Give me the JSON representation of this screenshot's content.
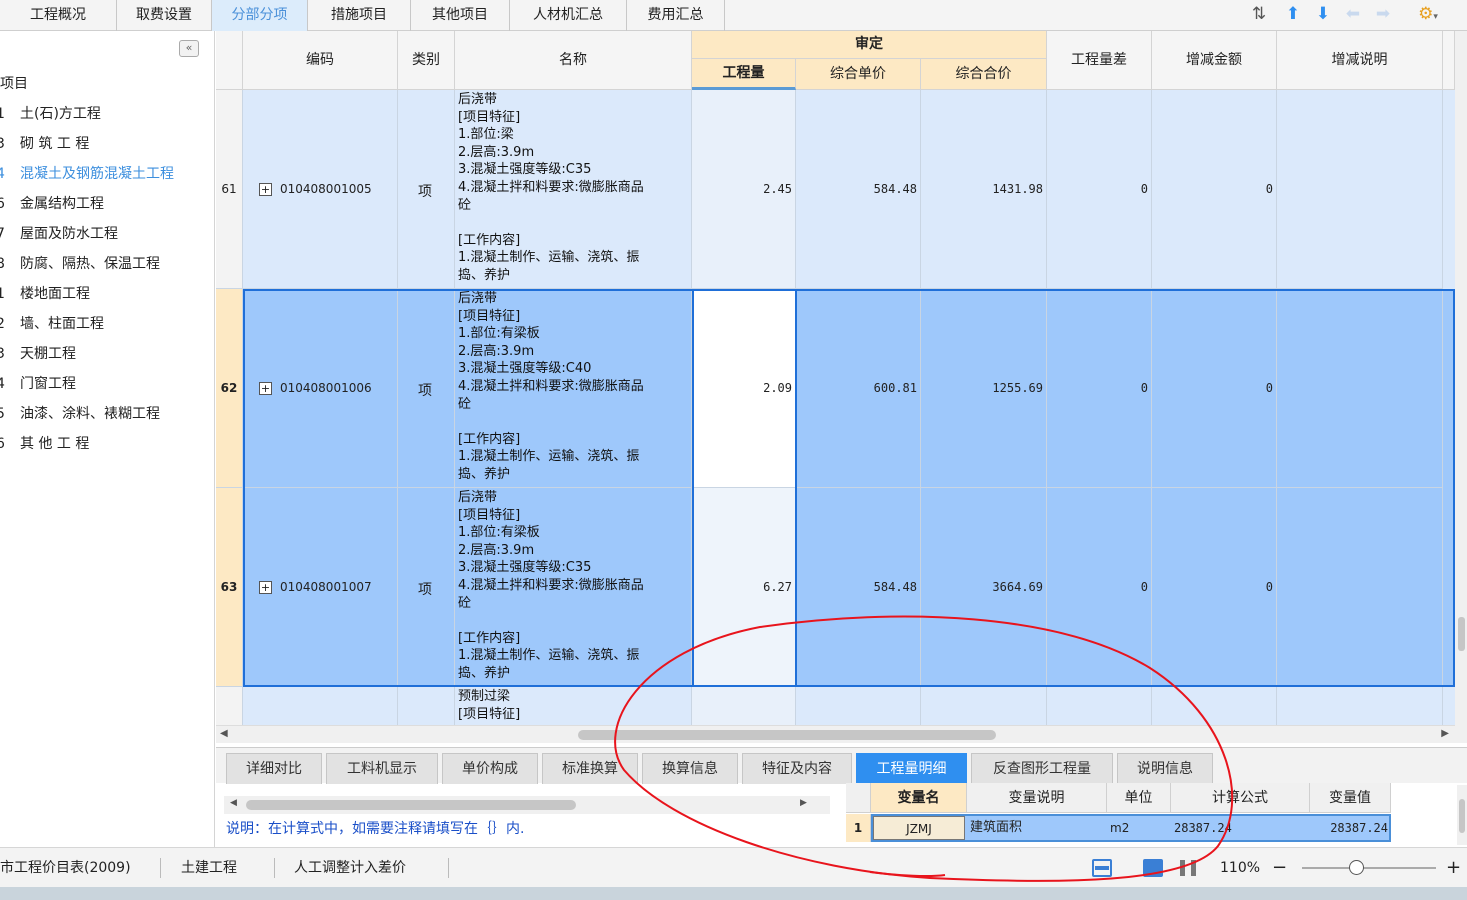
{
  "top_tabs": [
    "工程概况",
    "取费设置",
    "分部分项",
    "措施项目",
    "其他项目",
    "人材机汇总",
    "费用汇总"
  ],
  "active_top_tab": "分部分项",
  "toolbar_icons": [
    "sort-icon",
    "arrow-up-icon",
    "arrow-down-icon",
    "arrow-left-icon",
    "arrow-right-icon",
    "settings-icon"
  ],
  "tree": {
    "root_label": "项目",
    "items": [
      {
        "num": "1",
        "label": "土(石)方工程"
      },
      {
        "num": "3",
        "label": "砌 筑 工 程"
      },
      {
        "num": "4",
        "label": "混凝土及钢筋混凝土工程",
        "active": true
      },
      {
        "num": "6",
        "label": "金属结构工程"
      },
      {
        "num": "7",
        "label": "屋面及防水工程"
      },
      {
        "num": "8",
        "label": "防腐、隔热、保温工程"
      },
      {
        "num": "1",
        "label": "楼地面工程"
      },
      {
        "num": "2",
        "label": "墙、柱面工程"
      },
      {
        "num": "3",
        "label": "天棚工程"
      },
      {
        "num": "4",
        "label": "门窗工程"
      },
      {
        "num": "5",
        "label": "油漆、涂料、裱糊工程"
      },
      {
        "num": "6",
        "label": "其 他 工 程"
      }
    ]
  },
  "grid": {
    "headers": {
      "code": "编码",
      "type": "类别",
      "name": "名称",
      "group": "审定",
      "qty": "工程量",
      "unit_price": "综合单价",
      "total": "综合合价",
      "qty_diff": "工程量差",
      "amount_change": "增减金额",
      "change_note": "增减说明"
    },
    "rows": [
      {
        "row_no": "61",
        "code": "010408001005",
        "type": "项",
        "name": "后浇带\n[项目特征]\n1.部位:梁\n2.层高:3.9m\n3.混凝土强度等级:C35\n4.混凝土拌和料要求:微膨胀商品\n砼\n\n[工作内容]\n1.混凝土制作、运输、浇筑、振\n捣、养护",
        "qty": "2.45",
        "unit_price": "584.48",
        "total": "1431.98",
        "qty_diff": "0",
        "amount_change": "0",
        "selected": false
      },
      {
        "row_no": "62",
        "code": "010408001006",
        "type": "项",
        "name": "后浇带\n[项目特征]\n1.部位:有梁板\n2.层高:3.9m\n3.混凝土强度等级:C40\n4.混凝土拌和料要求:微膨胀商品\n砼\n\n[工作内容]\n1.混凝土制作、运输、浇筑、振\n捣、养护",
        "qty": "2.09",
        "unit_price": "600.81",
        "total": "1255.69",
        "qty_diff": "0",
        "amount_change": "0",
        "selected": true
      },
      {
        "row_no": "63",
        "code": "010408001007",
        "type": "项",
        "name": "后浇带\n[项目特征]\n1.部位:有梁板\n2.层高:3.9m\n3.混凝土强度等级:C35\n4.混凝土拌和料要求:微膨胀商品\n砼\n\n[工作内容]\n1.混凝土制作、运输、浇筑、振\n捣、养护",
        "qty": "6.27",
        "unit_price": "584.48",
        "total": "3664.69",
        "qty_diff": "0",
        "amount_change": "0",
        "selected": true
      },
      {
        "row_no": "",
        "code": "",
        "type": "",
        "name": "预制过梁\n[项目特征]",
        "qty": "",
        "unit_price": "",
        "total": "",
        "qty_diff": "",
        "amount_change": "",
        "selected": false
      }
    ]
  },
  "bottom_tabs": [
    "详细对比",
    "工料机显示",
    "单价构成",
    "标准换算",
    "换算信息",
    "特征及内容",
    "工程量明细",
    "反查图形工程量",
    "说明信息"
  ],
  "active_bottom_tab": "工程量明细",
  "note": "说明：在计算式中，如需要注释请填写在｛｝内.",
  "detail_table": {
    "headers": [
      "变量名",
      "变量说明",
      "单位",
      "计算公式",
      "变量值"
    ],
    "rows": [
      {
        "no": "1",
        "var_name": "JZMJ",
        "desc": "建筑面积",
        "unit": "m2",
        "formula": "28387.24",
        "value": "28387.24"
      }
    ]
  },
  "status_bar": {
    "items": [
      "市工程价目表(2009)",
      "土建工程",
      "人工调整计入差价"
    ],
    "zoom": "110%"
  },
  "colors": {
    "selected_row": "#9ec8fb",
    "normal_row": "#dbe9fb",
    "header_audit": "#fde9c4",
    "active_tab": "#2f8ff0",
    "annotation": "#e8141c"
  }
}
